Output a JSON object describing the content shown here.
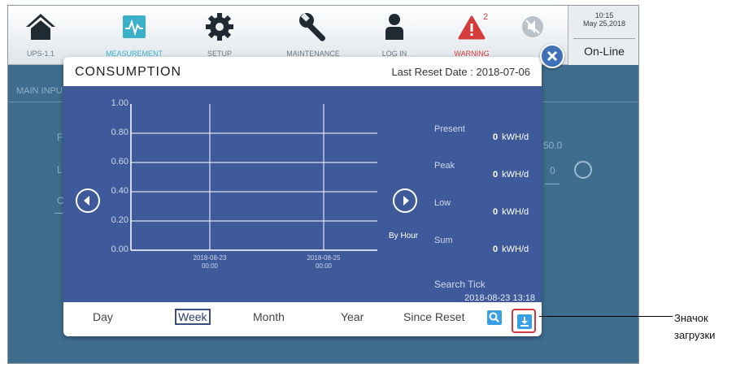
{
  "topbar": {
    "ups_label": "UPS-1.1",
    "measurement_label": "MEASUREMENT",
    "setup_label": "SETUP",
    "maintenance_label": "MAINTENANCE",
    "login_label": "LOG IN",
    "warning_label": "WARNING",
    "warning_count": "2",
    "time": "10:15",
    "date": "May 25,2018",
    "status": "On-Line"
  },
  "background": {
    "section_title": "MAIN INPUT",
    "row_labels": [
      "F",
      "L",
      "C"
    ],
    "values": [
      "50.0",
      "0"
    ]
  },
  "dialog": {
    "title": "CONSUMPTION",
    "last_reset": "Last Reset Date : 2018-07-06",
    "by_hour": "By Hour",
    "stats": [
      {
        "label": "Present",
        "value": "0",
        "unit": "kWH/d"
      },
      {
        "label": "Peak",
        "value": "0",
        "unit": "kWH/d"
      },
      {
        "label": "Low",
        "value": "0",
        "unit": "kWH/d"
      },
      {
        "label": "Sum",
        "value": "0",
        "unit": "kWH/d"
      }
    ],
    "search_tick_label": "Search Tick",
    "search_tick_value": "2018-08-23 13:18",
    "tabs": [
      "Day",
      "Week",
      "Month",
      "Year",
      "Since Reset"
    ],
    "selected_tab": "Week"
  },
  "chart_data": {
    "type": "line",
    "y_ticks": [
      "1.00",
      "0.80",
      "0.60",
      "0.40",
      "0.20",
      "0.00"
    ],
    "ylim": [
      0,
      1
    ],
    "x_ticks": [
      {
        "date": "2018-08-23",
        "time": "00:00"
      },
      {
        "date": "2018-08-25",
        "time": "00:00"
      }
    ],
    "series": [],
    "grid": true
  },
  "callout": {
    "text": "Значок загрузки"
  },
  "colors": {
    "screen_bg": "#3e6d8e",
    "chart_bg": "#3f5a9a",
    "accent_blue": "#3aa0e4",
    "highlight_red": "#d2383f",
    "warning_red": "#d43c3c"
  }
}
